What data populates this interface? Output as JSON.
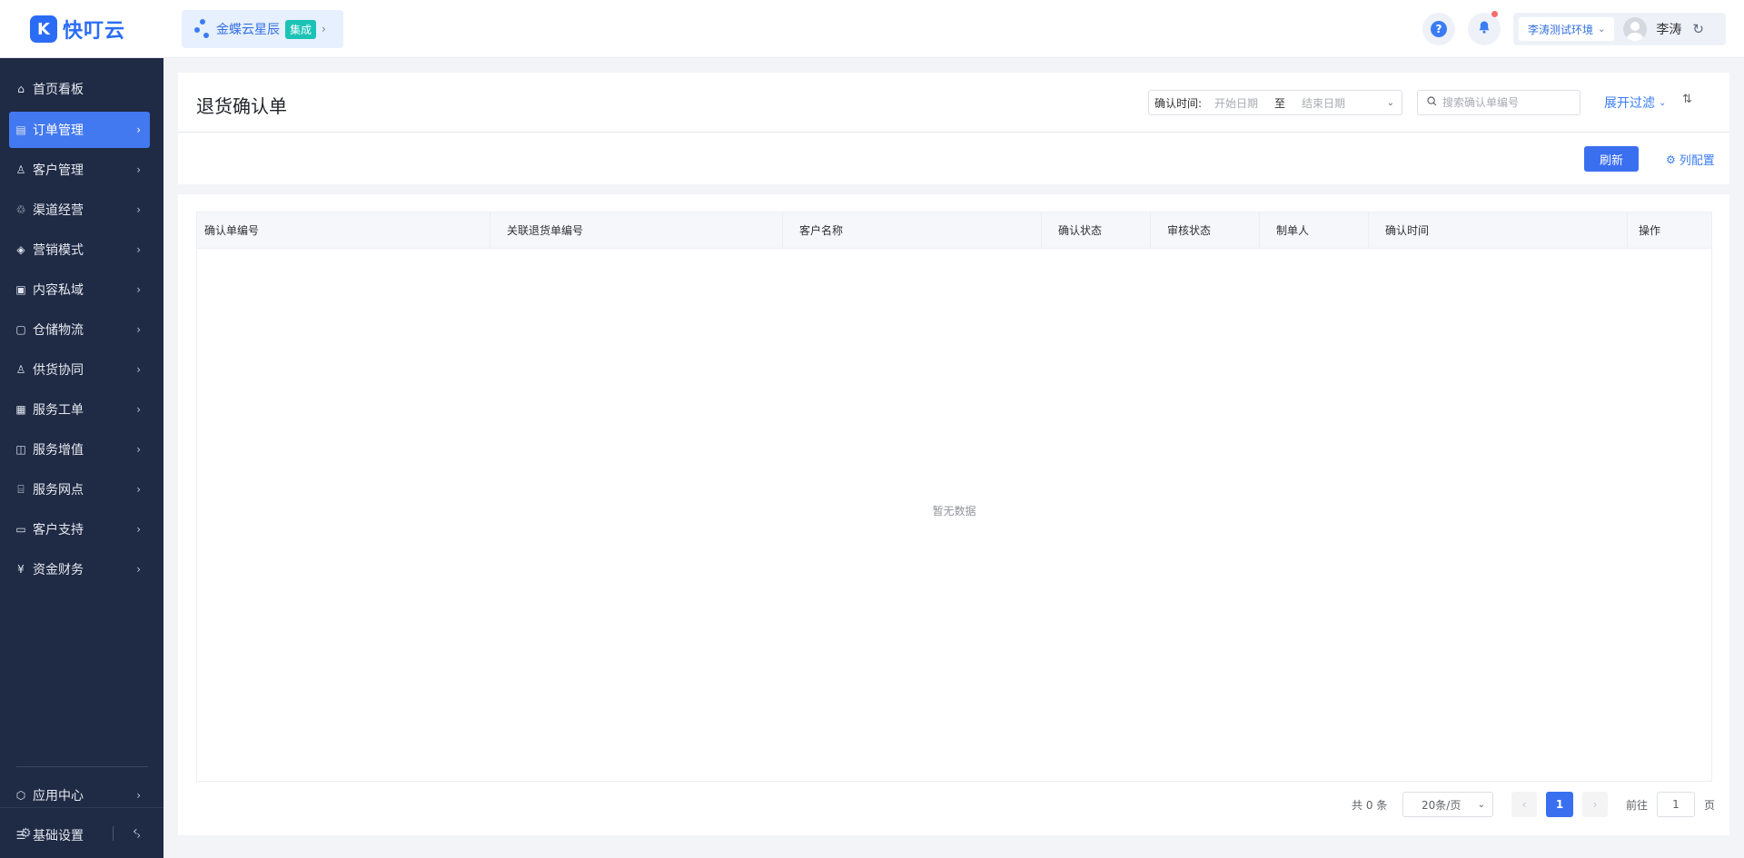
{
  "header": {
    "logo_mark": "K",
    "logo_text": "快叮云",
    "integration_label": "金蝶云星辰",
    "integration_badge": "集成",
    "help_glyph": "?",
    "environment": "李涛测试环境",
    "user_name": "李涛"
  },
  "sidebar": {
    "items": [
      {
        "label": "首页看板",
        "icon": "home-icon"
      },
      {
        "label": "订单管理",
        "icon": "order-icon"
      },
      {
        "label": "客户管理",
        "icon": "user-icon"
      },
      {
        "label": "渠道经营",
        "icon": "channel-icon"
      },
      {
        "label": "营销模式",
        "icon": "tag-icon"
      },
      {
        "label": "内容私域",
        "icon": "image-icon"
      },
      {
        "label": "仓储物流",
        "icon": "warehouse-icon"
      },
      {
        "label": "供货协同",
        "icon": "supply-icon"
      },
      {
        "label": "服务工单",
        "icon": "ticket-icon"
      },
      {
        "label": "服务增值",
        "icon": "bag-icon"
      },
      {
        "label": "服务网点",
        "icon": "store-icon"
      },
      {
        "label": "客户支持",
        "icon": "support-icon"
      },
      {
        "label": "资金财务",
        "icon": "yuan-icon"
      }
    ],
    "bottom_items": [
      {
        "label": "应用中心",
        "icon": "cube-icon"
      },
      {
        "label": "基础设置",
        "icon": "settings-list-icon"
      }
    ]
  },
  "page": {
    "title": "退货确认单",
    "filter": {
      "date_label": "确认时间:",
      "start_placeholder": "开始日期",
      "separator": "至",
      "end_placeholder": "结束日期",
      "search_placeholder": "搜索确认单编号",
      "expand_label": "展开过滤"
    },
    "refresh_label": "刷新",
    "column_config_label": "列配置"
  },
  "table": {
    "columns": [
      "确认单编号",
      "关联退货单编号",
      "客户名称",
      "确认状态",
      "审核状态",
      "制单人",
      "确认时间",
      "操作"
    ],
    "empty_text": "暂无数据"
  },
  "pagination": {
    "total_text": "共 0 条",
    "page_size": "20条/页",
    "current_page": "1",
    "goto_label": "前往",
    "goto_value": "1",
    "page_suffix": "页"
  }
}
